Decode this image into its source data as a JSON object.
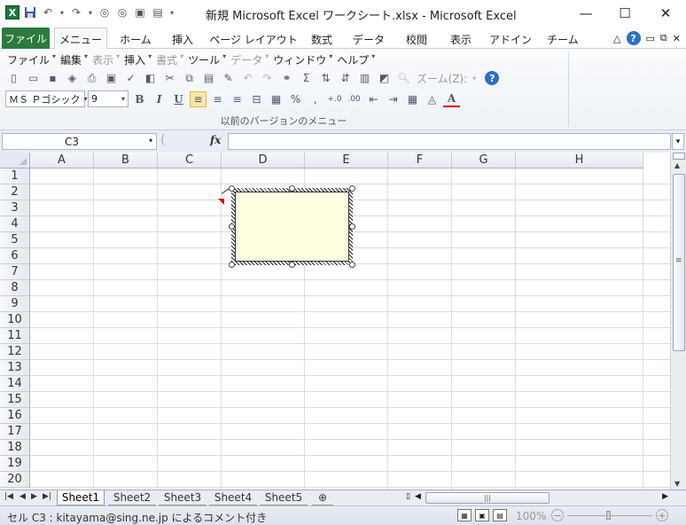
{
  "window": {
    "title": "新規 Microsoft Excel ワークシート.xlsx - Microsoft Excel",
    "minimize": "—",
    "maximize": "☐",
    "close": "✕"
  },
  "qat": {
    "logo": "X",
    "save_icon": "save-icon",
    "undo": "↶",
    "redo": "↷",
    "customize": "▾"
  },
  "tabs": [
    {
      "label": "ファイル"
    },
    {
      "label": "メニュー"
    },
    {
      "label": "ホーム"
    },
    {
      "label": "挿入"
    },
    {
      "label": "ページ レイアウト"
    },
    {
      "label": "数式"
    },
    {
      "label": "データ"
    },
    {
      "label": "校閲"
    },
    {
      "label": "表示"
    },
    {
      "label": "アドイン"
    },
    {
      "label": "チーム"
    }
  ],
  "tab_right": {
    "caret": "△",
    "help": "?",
    "min": "▭",
    "restore": "⧉",
    "close": "✕"
  },
  "menu": [
    {
      "label": "ファイル",
      "disabled": false
    },
    {
      "label": "編集",
      "disabled": false
    },
    {
      "label": "表示",
      "disabled": true
    },
    {
      "label": "挿入",
      "disabled": false
    },
    {
      "label": "書式",
      "disabled": true
    },
    {
      "label": "ツール",
      "disabled": false
    },
    {
      "label": "データ",
      "disabled": true
    },
    {
      "label": "ウィンドウ",
      "disabled": false
    },
    {
      "label": "ヘルプ",
      "disabled": false
    }
  ],
  "toolbar": {
    "zoom_label": "ズーム(Z):",
    "sigma": "Σ",
    "font_name": "ＭＳ Ｐゴシック",
    "font_size": "9",
    "bold": "B",
    "italic": "I",
    "underline": "U",
    "percent": "%",
    "comma": ",",
    "inc_decimal": "+.0",
    "dec_decimal": ".00",
    "font_color": "A",
    "help": "?",
    "group_label": "以前のバージョンのメニュー"
  },
  "formula_bar": {
    "name_box": "C3",
    "fx": "fx",
    "formula": ""
  },
  "grid": {
    "columns": [
      "A",
      "B",
      "C",
      "D",
      "E",
      "F",
      "G",
      "H"
    ],
    "rows": [
      "1",
      "2",
      "3",
      "4",
      "5",
      "6",
      "7",
      "8",
      "9",
      "10",
      "11",
      "12",
      "13",
      "14",
      "15",
      "16",
      "17",
      "18",
      "19",
      "20"
    ]
  },
  "sheets": [
    {
      "label": "Sheet1",
      "active": true
    },
    {
      "label": "Sheet2",
      "active": false
    },
    {
      "label": "Sheet3",
      "active": false
    },
    {
      "label": "Sheet4",
      "active": false
    },
    {
      "label": "Sheet5",
      "active": false
    }
  ],
  "status": {
    "text": "セル C3 : kitayama@sing.ne.jp によるコメント付き",
    "zoom": "100%"
  },
  "colors": {
    "file_tab": "#2c7a3f",
    "comment_bg": "#ffffe1",
    "comment_indicator": "#d00000"
  }
}
